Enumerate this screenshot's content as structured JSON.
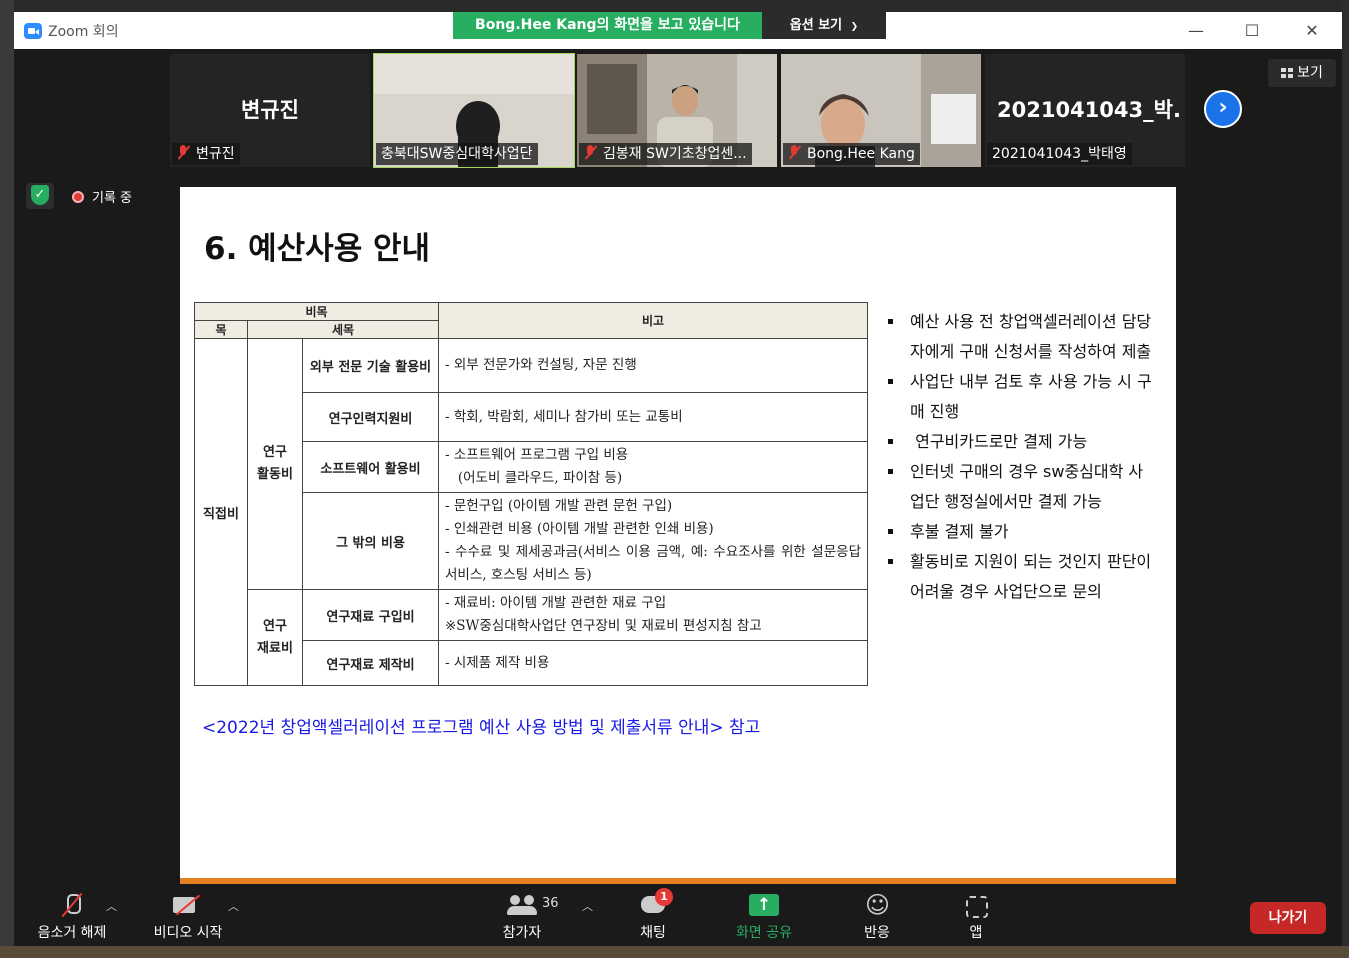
{
  "window": {
    "title": "Zoom 회의"
  },
  "banner": {
    "presenter": "Bong.Hee  Kang",
    "suffix": "의 화면을 보고 있습니다",
    "view_options": "옵션 보기"
  },
  "gallery": {
    "view_label": "보기",
    "participants": [
      {
        "big_name": "변규진",
        "label": "변규진",
        "muted": true,
        "video": false
      },
      {
        "label": "충북대SW중심대학사업단",
        "muted": false,
        "video": true,
        "active": true
      },
      {
        "label": "김봉재 SW기초창업센...",
        "muted": true,
        "video": true
      },
      {
        "label": "Bong.Hee Kang",
        "muted": true,
        "video": true
      },
      {
        "big_name": "2021041043_박...",
        "label": "2021041043_박태영",
        "muted": false,
        "video": false
      }
    ]
  },
  "meeting": {
    "recording_label": "기록 중"
  },
  "slide": {
    "title": "6. 예산사용 안내",
    "table": {
      "header_group": "비목",
      "header_item": "목",
      "header_subitem": "세목",
      "header_note": "비고",
      "category": "직접비",
      "group1": "연구\n활동비",
      "group2": "연구\n재료비",
      "rows": [
        {
          "name": "외부 전문 기술 활용비",
          "lines": [
            "- 외부 전문가와 컨설팅, 자문 진행"
          ]
        },
        {
          "name": "연구인력지원비",
          "lines": [
            "- 학회, 박람회, 세미나 참가비 또는 교통비"
          ]
        },
        {
          "name": "소프트웨어 활용비",
          "lines": [
            "- 소프트웨어 프로그램 구입 비용",
            "   (어도비 클라우드, 파이참 등)"
          ]
        },
        {
          "name": "그 밖의 비용",
          "lines": [
            "- 문헌구입 (아이템 개발 관련 문헌 구입)",
            "- 인쇄관련 비용 (아이템 개발 관련한 인쇄 비용)",
            "- 수수료 및 제세공과금(서비스 이용 금액, 예: 수요조사를 위한 설문응답 서비스, 호스팅 서비스 등)"
          ]
        },
        {
          "name": "연구재료 구입비",
          "lines": [
            "- 재료비: 아이템 개발 관련한 재료 구입",
            "※SW중심대학사업단 연구장비 및 재료비 편성지침 참고"
          ]
        },
        {
          "name": "연구재료 제작비",
          "lines": [
            "- 시제품 제작 비용"
          ]
        }
      ]
    },
    "bullets": [
      "예산 사용 전 창업액셀러레이션 담당자에게 구매 신청서를 작성하여 제출",
      "사업단 내부 검토 후 사용 가능 시 구매 진행",
      " 연구비카드로만 결제 가능",
      "인터넷 구매의 경우 sw중심대학 사업단 행정실에서만 결제 가능",
      "후불 결제 불가",
      "활동비로 지원이 되는 것인지 판단이 어려울 경우 사업단으로 문의"
    ],
    "reference": "<2022년 창업액셀러레이션 프로그램 예산 사용 방법 및 제출서류 안내> 참고"
  },
  "toolbar": {
    "unmute": "음소거 해제",
    "start_video": "비디오 시작",
    "participants": "참가자",
    "participant_count": "36",
    "chat": "채팅",
    "chat_badge": "1",
    "share_screen": "화면 공유",
    "reactions": "반응",
    "apps": "앱",
    "leave": "나가기"
  },
  "colors": {
    "share_green": "#27ae60",
    "leave_red": "#c62828",
    "link_blue": "#1a1ae6",
    "accent_orange": "#e67e22"
  }
}
